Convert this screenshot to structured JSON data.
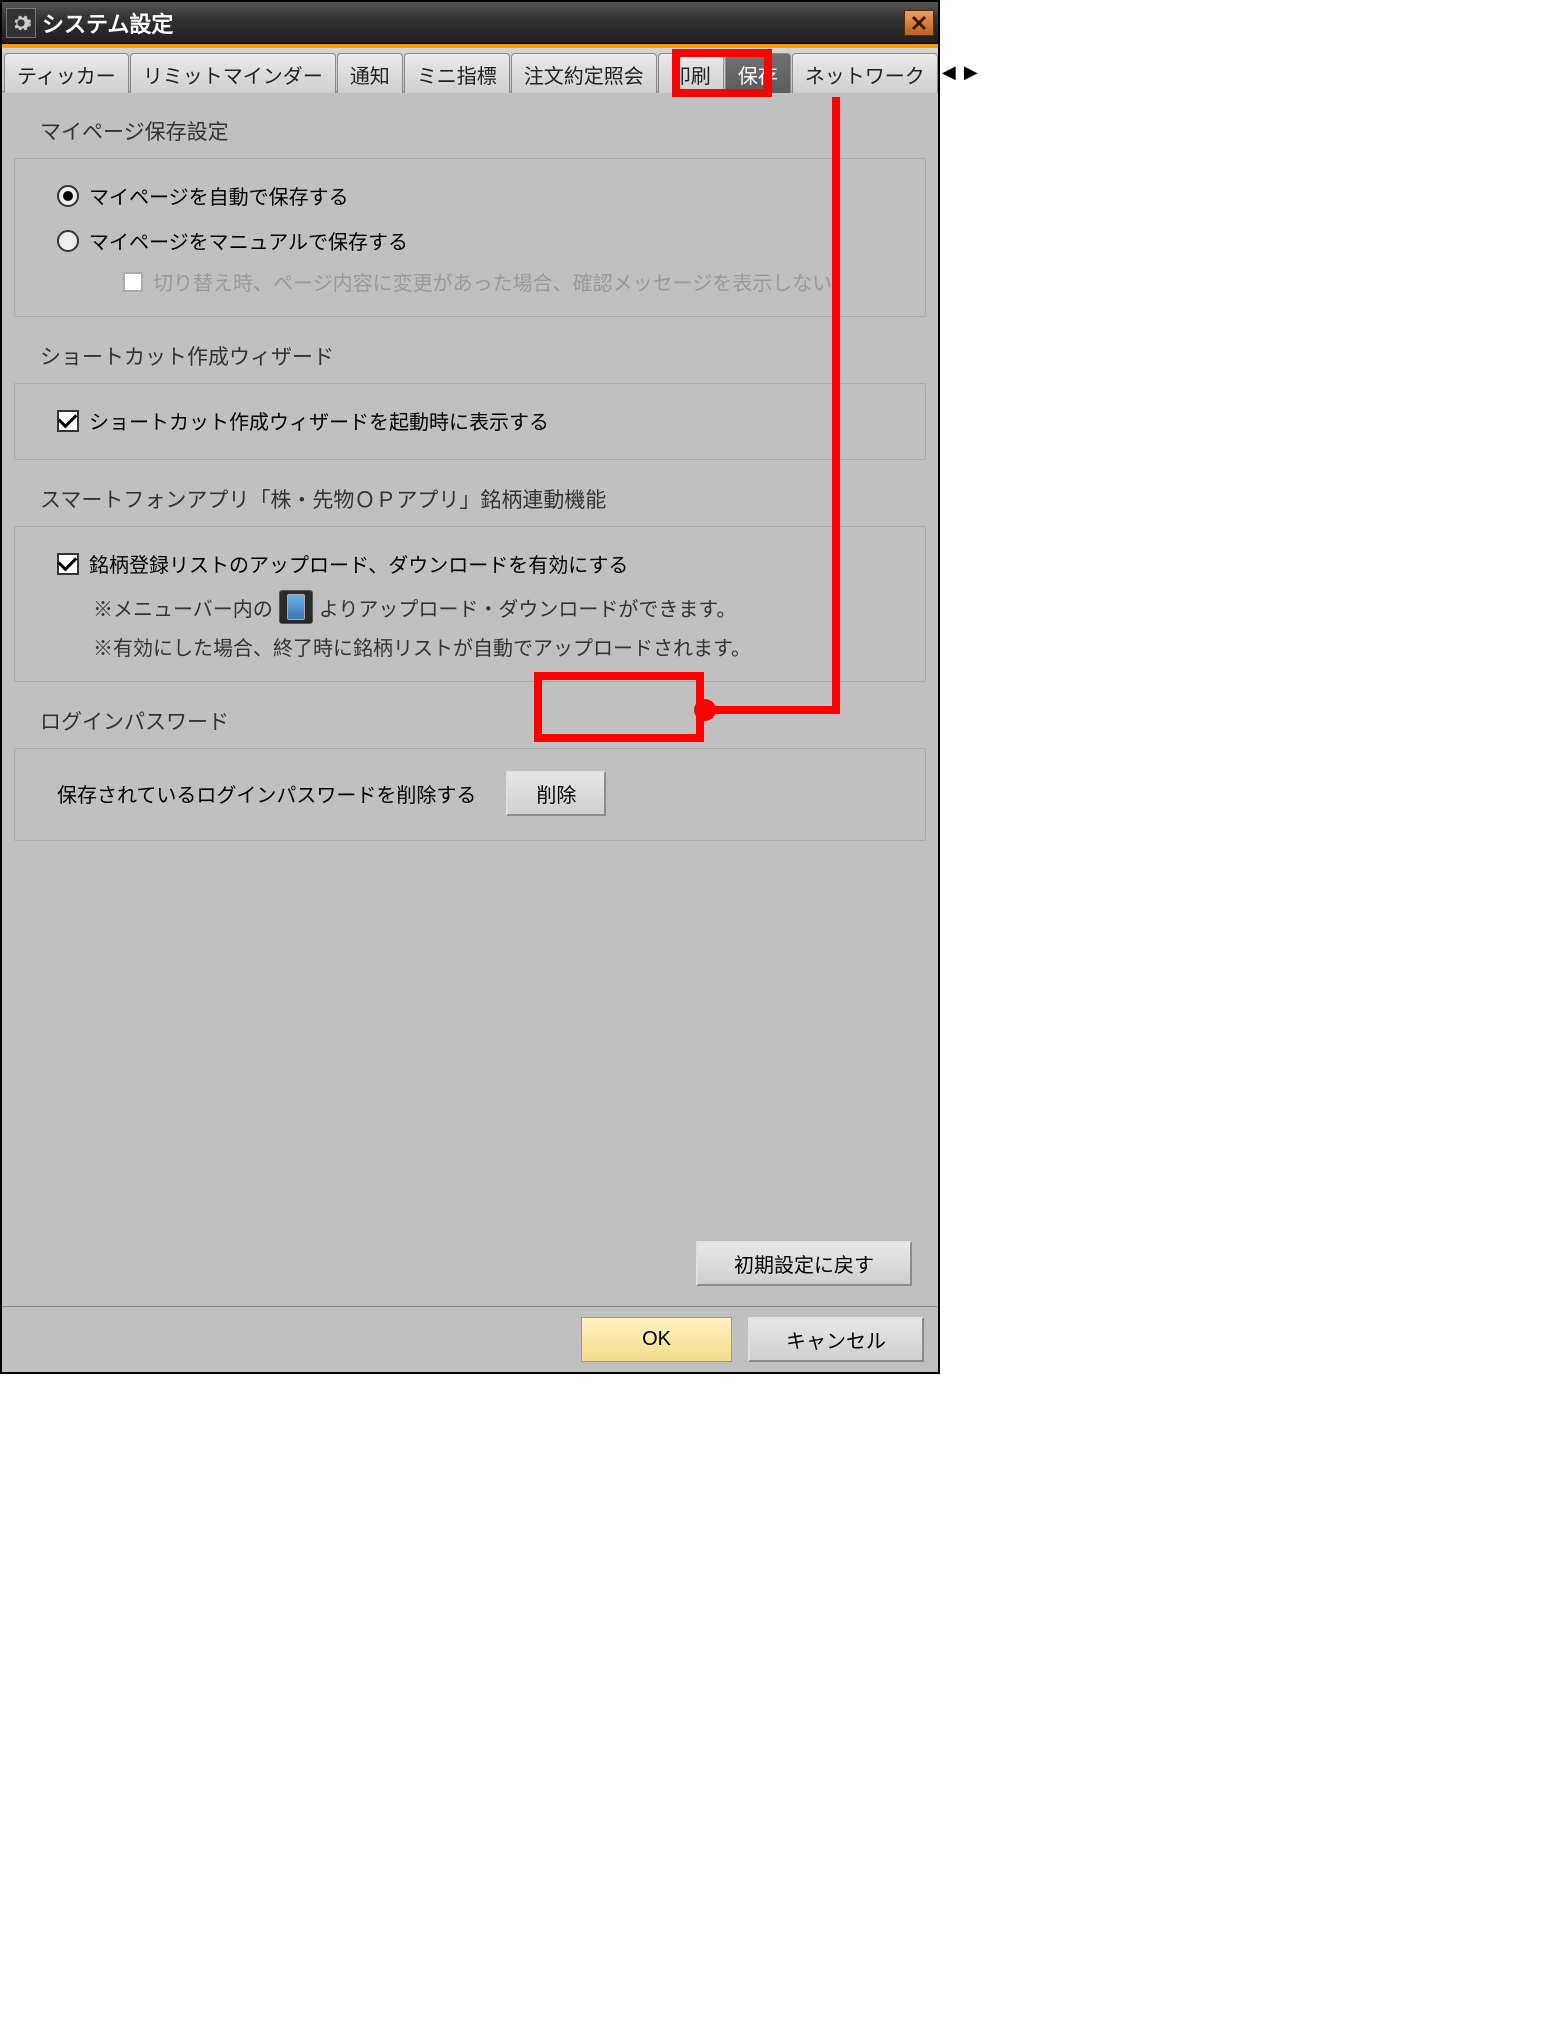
{
  "window": {
    "title": "システム設定"
  },
  "tabs": [
    "ティッカー",
    "リミットマインダー",
    "通知",
    "ミニ指標",
    "注文約定照会",
    "印刷",
    "保存",
    "ネットワーク"
  ],
  "activeTabIndex": 6,
  "mypage": {
    "title": "マイページ保存設定",
    "radio1": "マイページを自動で保存する",
    "radio2": "マイページをマニュアルで保存する",
    "checkboxNote": "切り替え時、ページ内容に変更があった場合、確認メッセージを表示しない"
  },
  "shortcut": {
    "title": "ショートカット作成ウィザード",
    "check": "ショートカット作成ウィザードを起動時に表示する"
  },
  "smartphone": {
    "title": "スマートフォンアプリ「株・先物ＯＰアプリ」銘柄連動機能",
    "check": "銘柄登録リストのアップロード、ダウンロードを有効にする",
    "note1a": "※メニューバー内の",
    "note1b": "よりアップロード・ダウンロードができます。",
    "note2": "※有効にした場合、終了時に銘柄リストが自動でアップロードされます。"
  },
  "login": {
    "title": "ログインパスワード",
    "label": "保存されているログインパスワードを削除する",
    "deleteBtn": "削除"
  },
  "buttons": {
    "reset": "初期設定に戻す",
    "ok": "OK",
    "cancel": "キャンセル"
  }
}
